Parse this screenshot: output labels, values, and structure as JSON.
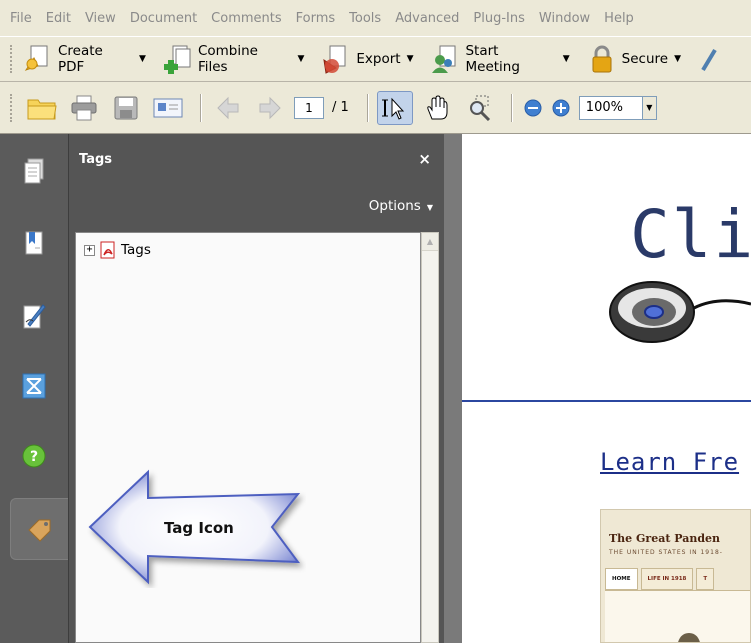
{
  "menu": [
    "File",
    "Edit",
    "View",
    "Document",
    "Comments",
    "Forms",
    "Tools",
    "Advanced",
    "Plug-Ins",
    "Window",
    "Help"
  ],
  "tasks": [
    {
      "label": "Create PDF",
      "icon": "create-pdf-icon"
    },
    {
      "label": "Combine Files",
      "icon": "combine-files-icon"
    },
    {
      "label": "Export",
      "icon": "export-icon"
    },
    {
      "label": "Start Meeting",
      "icon": "start-meeting-icon"
    },
    {
      "label": "Secure",
      "icon": "lock-icon"
    }
  ],
  "toolbar": {
    "page_current": "1",
    "page_total": "/ 1",
    "zoom": "100%"
  },
  "nav": [
    "pages-icon",
    "bookmarks-icon",
    "signatures-icon",
    "model-tree-icon",
    "help-icon",
    "tag-icon"
  ],
  "panel": {
    "title": "Tags",
    "close": "×",
    "options_label": "Options",
    "tree_root": "Tags"
  },
  "document": {
    "logo_text": "Cli",
    "link_text": "Learn Fre",
    "thumb_title": "The Great Panden",
    "thumb_subtitle": "THE UNITED STATES IN 1918-",
    "thumb_tabs": [
      "HOME",
      "LIFE IN 1918",
      "T"
    ]
  },
  "annotation": {
    "label": "Tag Icon"
  },
  "colors": {
    "panel_bg": "#555555",
    "nav_bg": "#5b5b5b",
    "arrow_fill": "#4e5fc0",
    "link": "#1c2f88"
  }
}
